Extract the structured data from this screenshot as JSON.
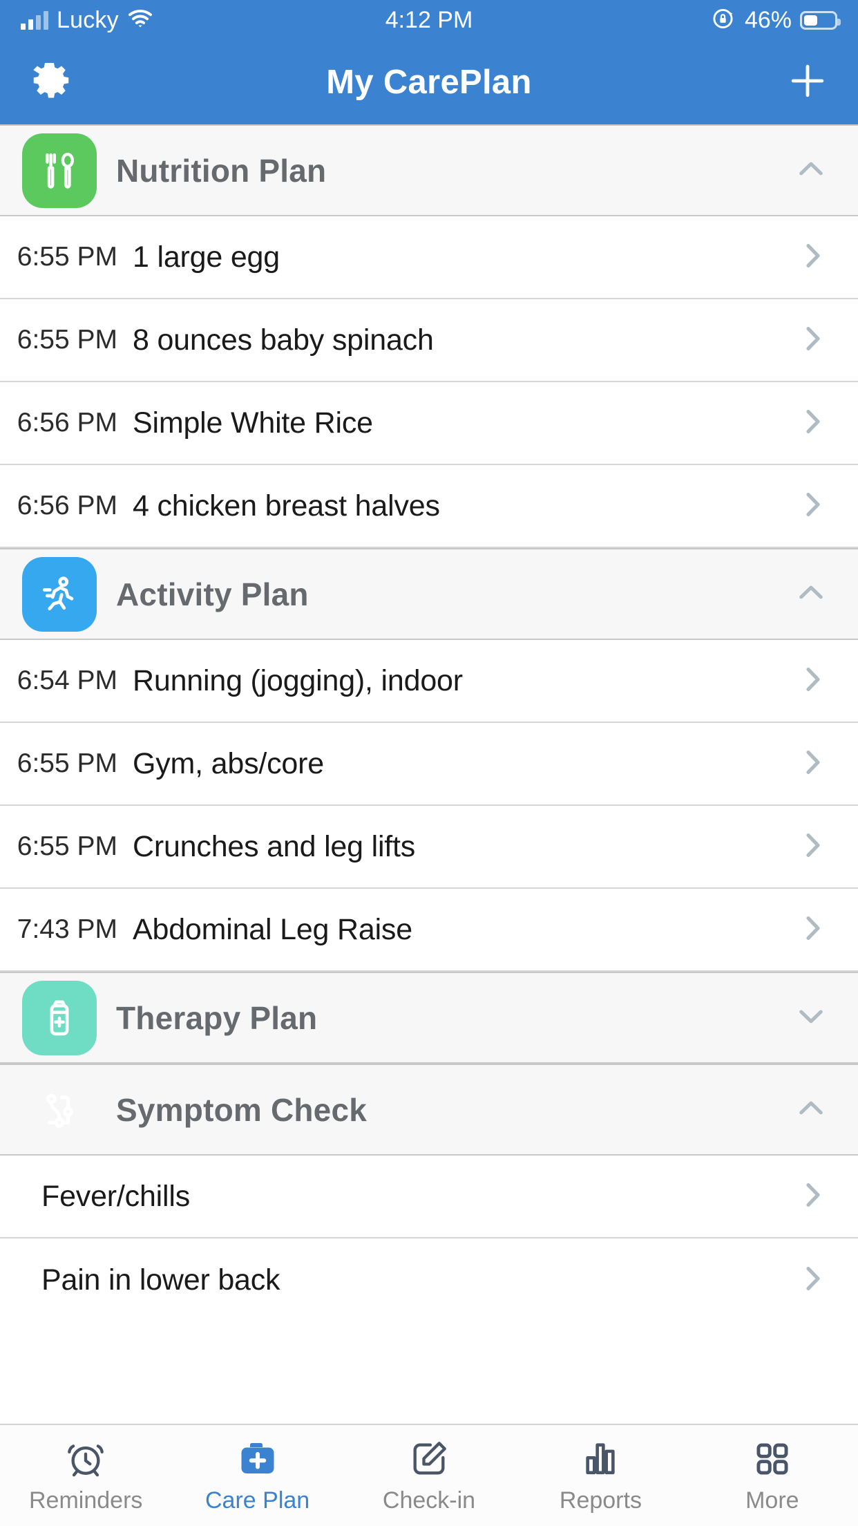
{
  "status_bar": {
    "carrier": "Lucky",
    "time": "4:12 PM",
    "battery_percent": "46%",
    "signal_icon": "cellular-bars-icon",
    "wifi_icon": "wifi-icon",
    "rotation_lock_icon": "rotation-lock-icon",
    "battery_icon": "battery-icon"
  },
  "nav_bar": {
    "title": "My CarePlan",
    "settings_icon": "gear-icon",
    "add_icon": "plus-icon",
    "background_color": "#3B83D1"
  },
  "sections": [
    {
      "title": "Nutrition Plan",
      "icon": "fork-and-spoon-icon",
      "color": "#5CC95F",
      "expanded": true,
      "chevron": "chevron-up-icon",
      "rows": [
        {
          "time": "6:55 PM",
          "label": "1 large egg"
        },
        {
          "time": "6:55 PM",
          "label": "8 ounces baby spinach"
        },
        {
          "time": "6:56 PM",
          "label": "Simple White Rice"
        },
        {
          "time": "6:56 PM",
          "label": "4 chicken breast halves"
        }
      ]
    },
    {
      "title": "Activity Plan",
      "icon": "running-person-icon",
      "color": "#35A8F0",
      "expanded": true,
      "chevron": "chevron-up-icon",
      "rows": [
        {
          "time": "6:54 PM",
          "label": "Running (jogging), indoor"
        },
        {
          "time": "6:55 PM",
          "label": "Gym, abs/core"
        },
        {
          "time": "6:55 PM",
          "label": "Crunches and leg lifts"
        },
        {
          "time": "7:43 PM",
          "label": "Abdominal Leg Raise"
        }
      ]
    },
    {
      "title": "Therapy Plan",
      "icon": "medicine-bottle-icon",
      "color": "#6FDDC4",
      "expanded": false,
      "chevron": "chevron-down-icon",
      "rows": []
    },
    {
      "title": "Symptom Check",
      "icon": "stethoscope-icon",
      "color": "#F5A council",
      "expanded": true,
      "chevron": "chevron-up-icon",
      "rows": [
        {
          "time": "",
          "label": "Fever/chills"
        },
        {
          "time": "",
          "label": "Pain in lower back"
        }
      ]
    }
  ],
  "tab_bar": {
    "active_color": "#3B83D1",
    "inactive_color": "#8A8A8A",
    "tabs": [
      {
        "label": "Reminders",
        "icon": "alarm-clock-icon",
        "active": false
      },
      {
        "label": "Care Plan",
        "icon": "medical-briefcase-plus-icon",
        "active": true
      },
      {
        "label": "Check-in",
        "icon": "edit-pencil-square-icon",
        "active": false
      },
      {
        "label": "Reports",
        "icon": "bar-chart-icon",
        "active": false
      },
      {
        "label": "More",
        "icon": "grid-squares-icon",
        "active": false
      }
    ]
  }
}
